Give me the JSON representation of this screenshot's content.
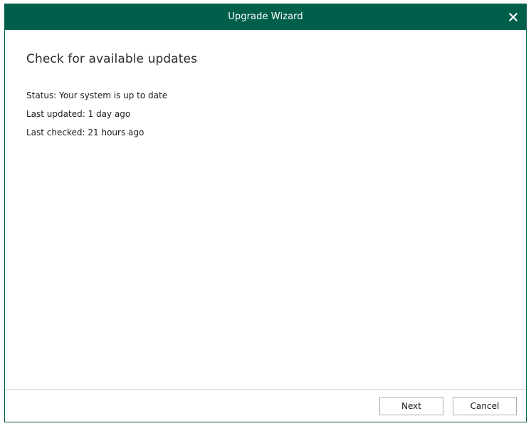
{
  "window": {
    "title": "Upgrade Wizard"
  },
  "icons": {
    "close": "close-icon"
  },
  "colors": {
    "titlebar": "#005f4b",
    "title_text": "#ffffff"
  },
  "page": {
    "heading": "Check for available updates",
    "status": "Status: Your system is up to date",
    "last_updated": "Last updated: 1 day ago",
    "last_checked": "Last checked: 21 hours ago"
  },
  "footer": {
    "next_label": "Next",
    "cancel_label": "Cancel"
  }
}
